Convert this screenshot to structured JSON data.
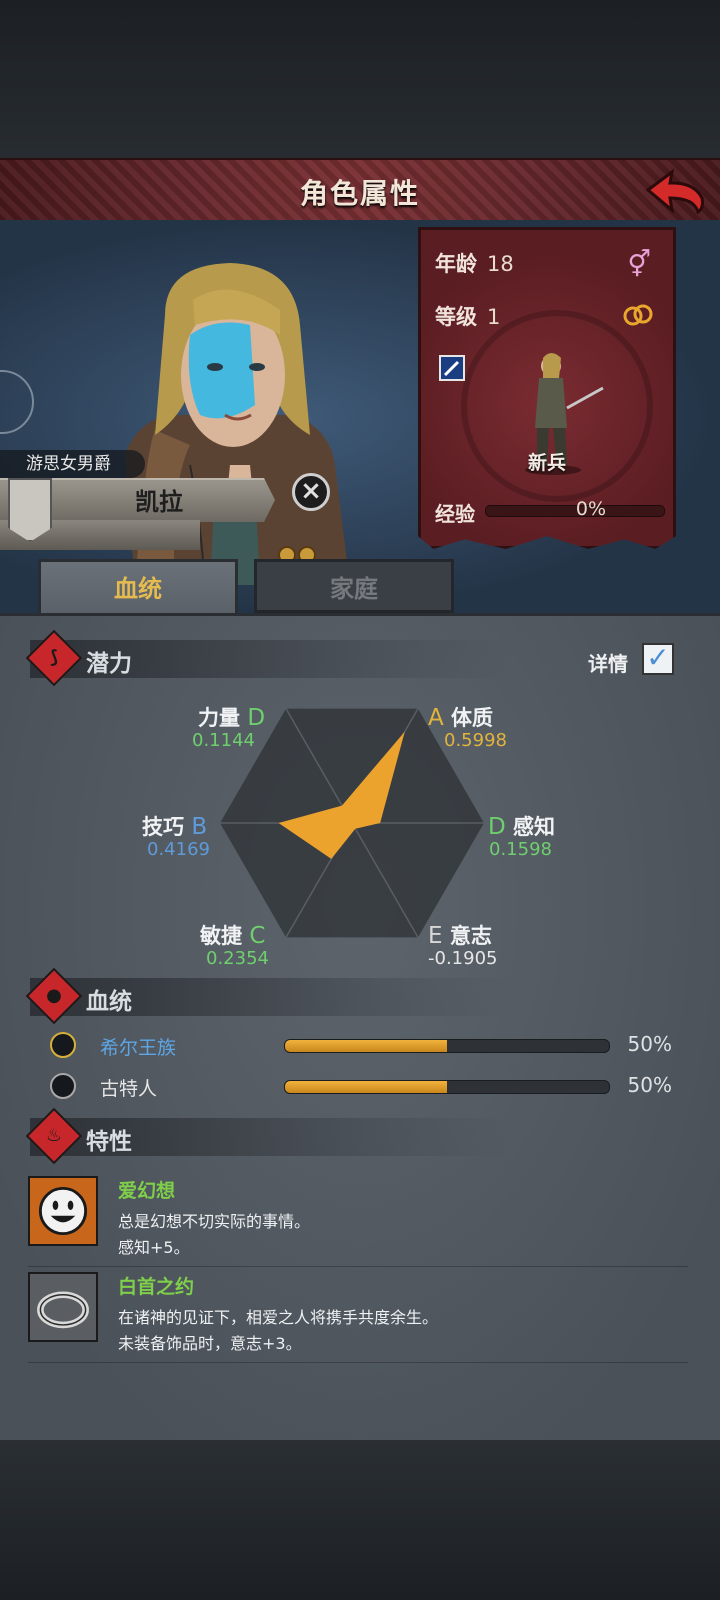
{
  "header": {
    "title": "角色属性"
  },
  "character": {
    "title": "游思女男爵",
    "name": "凯拉",
    "unit_class": "新兵"
  },
  "stats_card": {
    "age_label": "年龄",
    "age_value": "18",
    "level_label": "等级",
    "level_value": "1",
    "xp_label": "经验",
    "xp_value": "0%",
    "xp_fraction": 0.0,
    "gender": "female"
  },
  "tabs": [
    {
      "label": "血统",
      "active": true
    },
    {
      "label": "家庭",
      "active": false
    }
  ],
  "potential": {
    "section_title": "潜力",
    "detail_label": "详情",
    "detail_checked": true,
    "attributes": [
      {
        "name": "体质",
        "grade": "A",
        "value": "0.5998",
        "grade_color": "#e2b43c",
        "value_color": "#e2b43c"
      },
      {
        "name": "感知",
        "grade": "D",
        "value": "0.1598",
        "grade_color": "#6fcf6f",
        "value_color": "#6fcf6f"
      },
      {
        "name": "意志",
        "grade": "E",
        "value": "-0.1905",
        "grade_color": "#d8d8d8",
        "value_color": "#e6e6e6"
      },
      {
        "name": "敏捷",
        "grade": "C",
        "value": "0.2354",
        "grade_color": "#6fcf6f",
        "value_color": "#6fcf6f"
      },
      {
        "name": "技巧",
        "grade": "B",
        "value": "0.4169",
        "grade_color": "#5f9bd9",
        "value_color": "#5f9bd9"
      },
      {
        "name": "力量",
        "grade": "D",
        "value": "0.1144",
        "grade_color": "#6fcf6f",
        "value_color": "#6fcf6f"
      }
    ]
  },
  "lineage": {
    "section_title": "血统",
    "items": [
      {
        "name": "希尔王族",
        "percent": "50%",
        "fraction": 0.5,
        "name_color": "#5ea6e6"
      },
      {
        "name": "古特人",
        "percent": "50%",
        "fraction": 0.5,
        "name_color": "#e6e6e6"
      }
    ]
  },
  "traits": {
    "section_title": "特性",
    "items": [
      {
        "name": "爱幻想",
        "desc1": "总是幻想不切实际的事情。",
        "desc2": "感知+5。"
      },
      {
        "name": "白首之约",
        "desc1": "在诸神的见证下，相爱之人将携手共度余生。",
        "desc2": "未装备饰品时，意志+3。"
      }
    ]
  },
  "colors": {
    "accent": "#e5bb4f",
    "header_red": "#6b2a2e",
    "card_red": "#6a252a",
    "radar_fill": "#eba32e"
  }
}
